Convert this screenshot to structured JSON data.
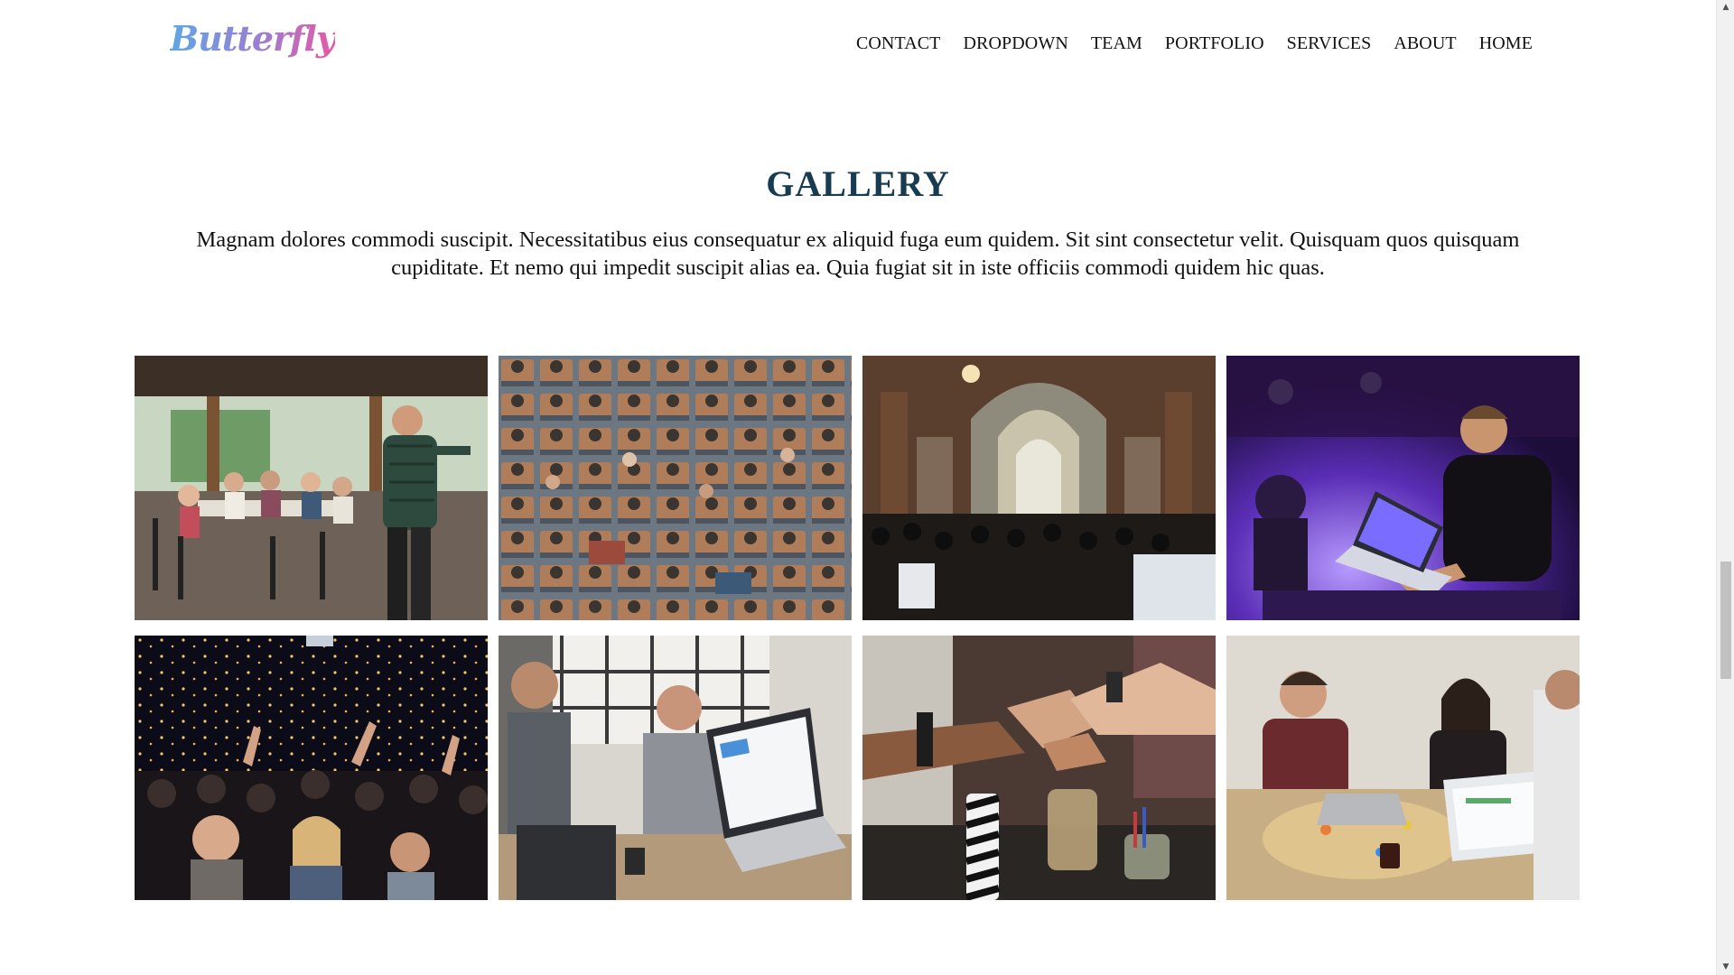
{
  "header": {
    "logo_text": "Butterfly",
    "nav": [
      "CONTACT",
      "DROPDOWN",
      "TEAM",
      "PORTFOLIO",
      "SERVICES",
      "ABOUT",
      "HOME"
    ]
  },
  "gallery": {
    "title": "GALLERY",
    "description": "Magnam dolores commodi suscipit. Necessitatibus eius consequatur ex aliquid fuga eum quidem. Sit sint consectetur velit. Quisquam quos quisquam cupiditate. Et nemo qui impedit suscipit alias ea. Quia fugiat sit in iste officiis commodi quidem hic quas."
  },
  "colors": {
    "title": "#173b50",
    "logo_gradient": [
      "#5ea7e3",
      "#9b7fd0",
      "#e659a5"
    ],
    "scrollbar_track": "#f1f1f1",
    "scrollbar_thumb": "#c1c1c1"
  },
  "scrollbar": {
    "position_fraction": 0.66
  },
  "icons": {
    "scroll_up": "triangle-up-icon",
    "scroll_down": "triangle-down-icon"
  }
}
